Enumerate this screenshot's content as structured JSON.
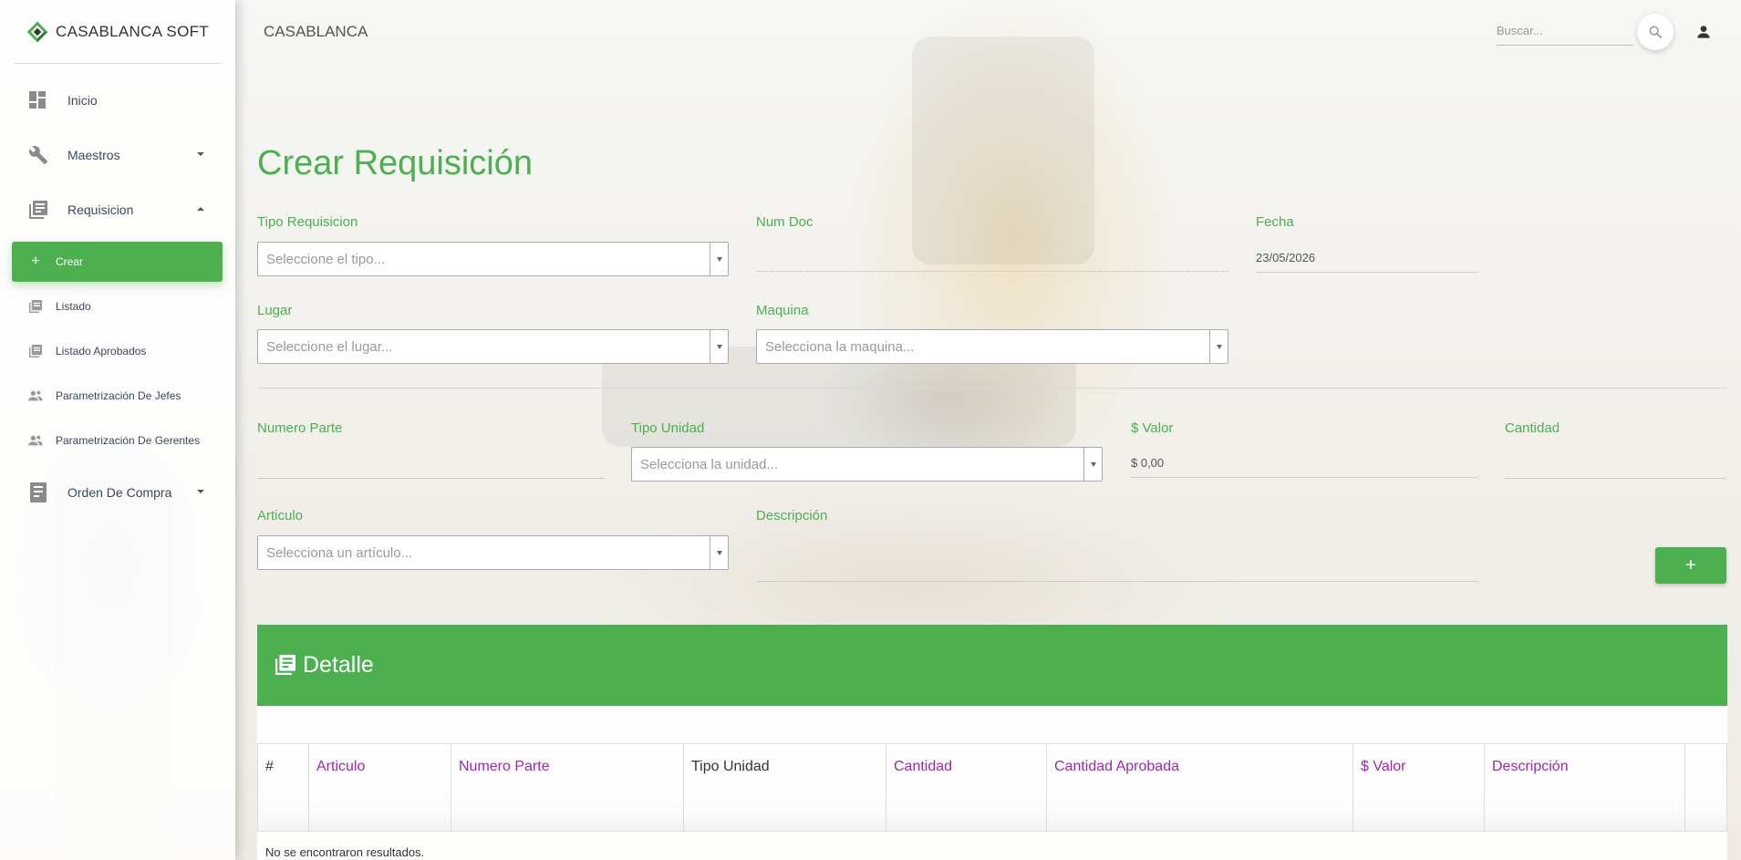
{
  "brand": {
    "name": "CASABLANCA SOFT"
  },
  "sidebar": {
    "items": [
      {
        "label": "Inicio"
      },
      {
        "label": "Maestros"
      },
      {
        "label": "Requisicion"
      }
    ],
    "requisicion_sub": [
      {
        "label": "Crear"
      },
      {
        "label": "Listado"
      },
      {
        "label": "Listado Aprobados"
      },
      {
        "label": "Parametrización De Jefes"
      },
      {
        "label": "Parametrización De Gerentes"
      }
    ],
    "orden": {
      "label": "Orden De Compra"
    }
  },
  "topbar": {
    "title": "CASABLANCA",
    "search_placeholder": "Buscar..."
  },
  "form": {
    "title": "Crear Requisición",
    "tipo_requisicion": {
      "label": "Tipo Requisicion",
      "placeholder": "Seleccione el tipo..."
    },
    "num_doc": {
      "label": "Num Doc",
      "value": ""
    },
    "fecha": {
      "label": "Fecha",
      "value": "23/05/2026"
    },
    "lugar": {
      "label": "Lugar",
      "placeholder": "Seleccione el lugar..."
    },
    "maquina": {
      "label": "Maquina",
      "placeholder": "Selecciona la maquina..."
    },
    "numero_parte": {
      "label": "Numero Parte",
      "value": ""
    },
    "tipo_unidad": {
      "label": "Tipo Unidad",
      "placeholder": "Selecciona la unidad..."
    },
    "valor": {
      "label": "$ Valor",
      "value": "$ 0,00"
    },
    "cantidad": {
      "label": "Cantidad",
      "value": ""
    },
    "articulo": {
      "label": "Articulo",
      "placeholder": "Selecciona un artículo..."
    },
    "descripcion": {
      "label": "Descripción",
      "value": ""
    },
    "add_label": "+"
  },
  "detail": {
    "title": "Detalle",
    "columns": [
      "#",
      "Articulo",
      "Numero Parte",
      "Tipo Unidad",
      "Cantidad",
      "Cantidad Aprobada",
      "$ Valor",
      "Descripción",
      ""
    ],
    "empty_message": "No se encontraron resultados."
  },
  "colors": {
    "accent": "#4caf50",
    "column_header": "#9c27b0"
  }
}
